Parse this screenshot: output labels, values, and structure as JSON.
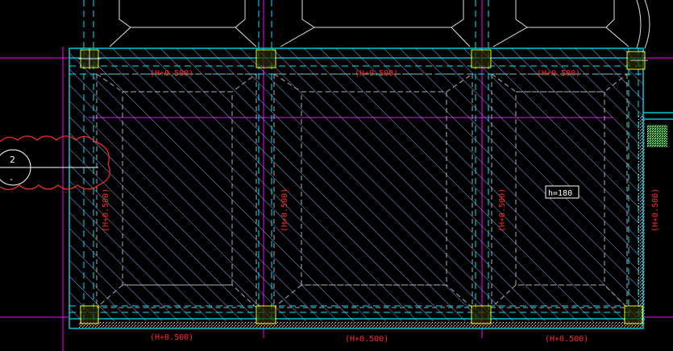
{
  "drawing": {
    "labels": {
      "top_left": "(H+0.500)",
      "top_mid": "(H+0.500)",
      "top_right": "(H+0.500)",
      "bottom_left": "(H+0.500)",
      "bottom_mid": "(H+0.500)",
      "bottom_right": "(H+0.500)",
      "side_1": "(H+0.500)",
      "side_2": "(H+0.500)",
      "side_3": "(H+0.500)",
      "side_4": "(H+0.500)"
    },
    "thickness_note": "h=180",
    "section_marker": {
      "number": "2",
      "sub": "-"
    },
    "colors": {
      "background": "#000000",
      "slab_outline": "#00e5ff",
      "hatch": "#7fa8ff",
      "dashed": "#00e5ff",
      "panel_edges": "#b0b0b0",
      "column": "#ffff00",
      "grid_line": "#ff00ff",
      "text": "#ff2a2a",
      "cloud": "#ff2a2a",
      "top_lines": "#e0e0e0"
    }
  }
}
